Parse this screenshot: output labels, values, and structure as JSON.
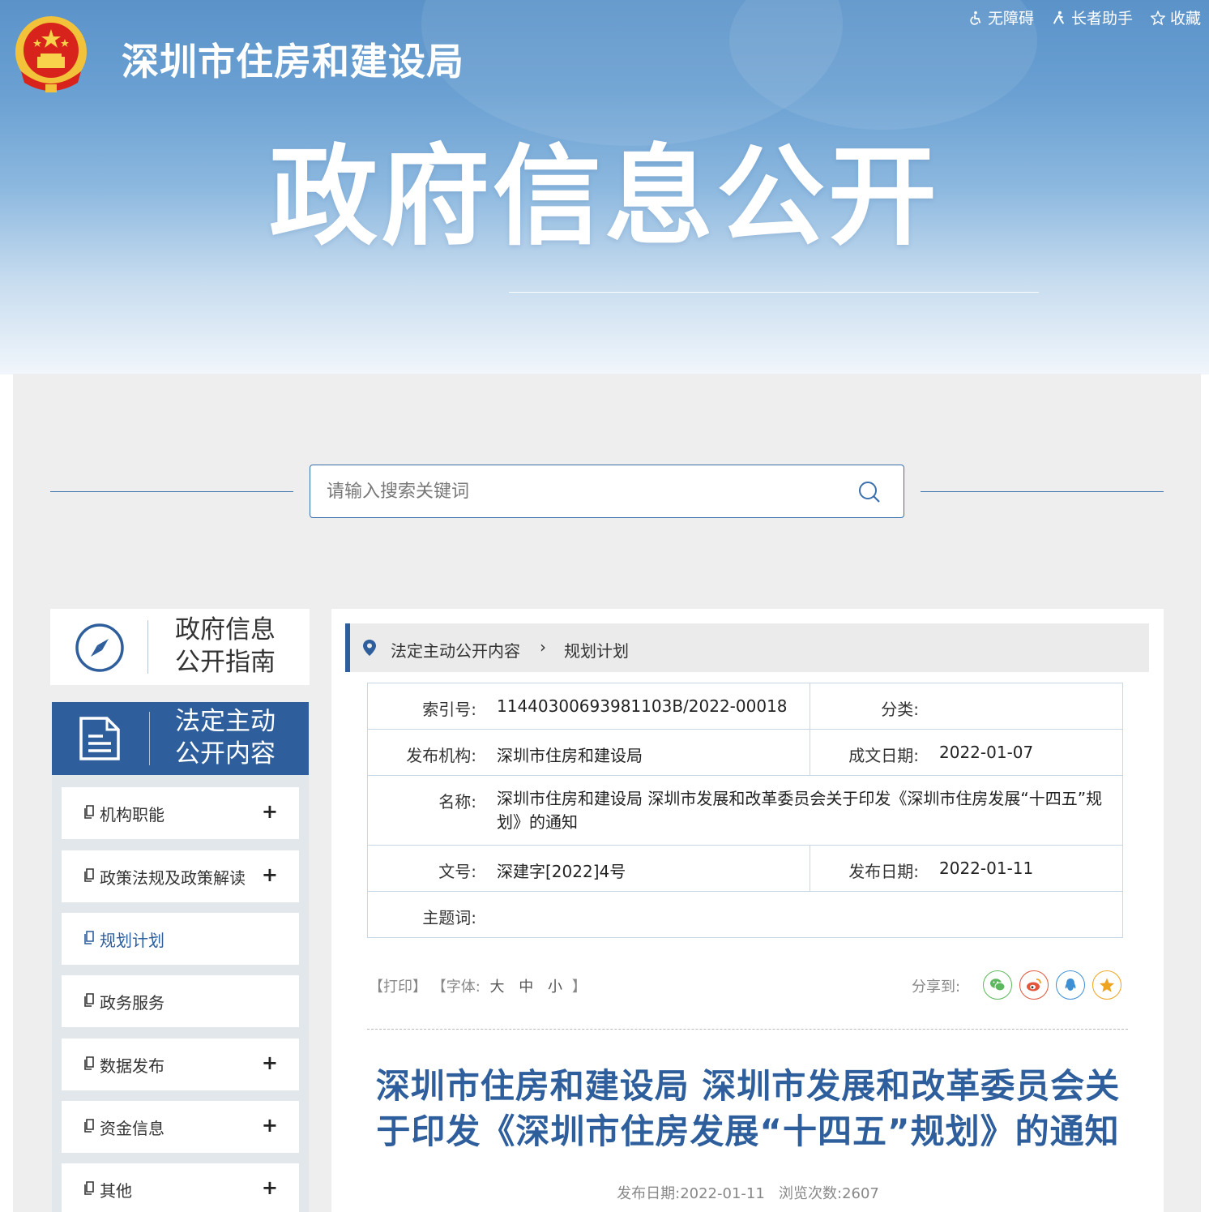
{
  "header": {
    "site_title": "深圳市住房和建设局",
    "hero_title": "政府信息公开",
    "top_links": [
      {
        "label": "无障碍",
        "icon": "accessibility-icon"
      },
      {
        "label": "长者助手",
        "icon": "elder-assist-icon"
      },
      {
        "label": "收藏",
        "icon": "star-icon"
      }
    ]
  },
  "search": {
    "placeholder": "请输入搜索关键词",
    "value": ""
  },
  "sidebar": {
    "guide": {
      "line1": "政府信息",
      "line2": "公开指南",
      "icon": "compass-icon"
    },
    "active": {
      "line1": "法定主动",
      "line2": "公开内容",
      "icon": "document-icon"
    },
    "items": [
      {
        "label": "机构职能",
        "expandable": "+"
      },
      {
        "label": "政策法规及政策解读",
        "expandable": "+"
      },
      {
        "label": "规划计划",
        "expandable": ""
      },
      {
        "label": "政务服务",
        "expandable": ""
      },
      {
        "label": "数据发布",
        "expandable": "+"
      },
      {
        "label": "资金信息",
        "expandable": "+"
      },
      {
        "label": "其他",
        "expandable": "+"
      }
    ]
  },
  "breadcrumb": {
    "items": [
      "法定主动公开内容",
      "规划计划"
    ],
    "separator": "›"
  },
  "info": {
    "index_label": "索引号:",
    "index_value": "11440300693981103B/2022-00018",
    "category_label": "分类:",
    "category_value": "",
    "publisher_label": "发布机构:",
    "publisher_value": "深圳市住房和建设局",
    "written_date_label": "成文日期:",
    "written_date_value": "2022-01-07",
    "name_label": "名称:",
    "name_value": "深圳市住房和建设局 深圳市发展和改革委员会关于印发《深圳市住房发展“十四五”规划》的通知",
    "doc_no_label": "文号:",
    "doc_no_value": "深建字[2022]4号",
    "publish_date_label": "发布日期:",
    "publish_date_value": "2022-01-11",
    "keywords_label": "主题词:",
    "keywords_value": ""
  },
  "tools": {
    "print": "【打印】",
    "font_open": "【字体:",
    "font_large": "大",
    "font_medium": "中",
    "font_small": "小",
    "font_close": "】",
    "share_label": "分享到:",
    "share_targets": [
      "wechat",
      "weibo",
      "qq",
      "qzone"
    ]
  },
  "article": {
    "title_line1": "深圳市住房和建设局 深圳市发展和改革委员会关",
    "title_line2": "于印发《深圳市住房发展“十四五”规划》的通知",
    "meta_date_label": "发布日期:",
    "meta_date": "2022-01-11",
    "meta_views_label": "浏览次数:",
    "meta_views": "2607"
  },
  "colors": {
    "primary": "#2e5f9c",
    "panel_bg": "#eeeeee",
    "wechat": "#5cb85c",
    "weibo": "#e2563c",
    "qq": "#3d8fd6",
    "qzone": "#f0a31e"
  }
}
